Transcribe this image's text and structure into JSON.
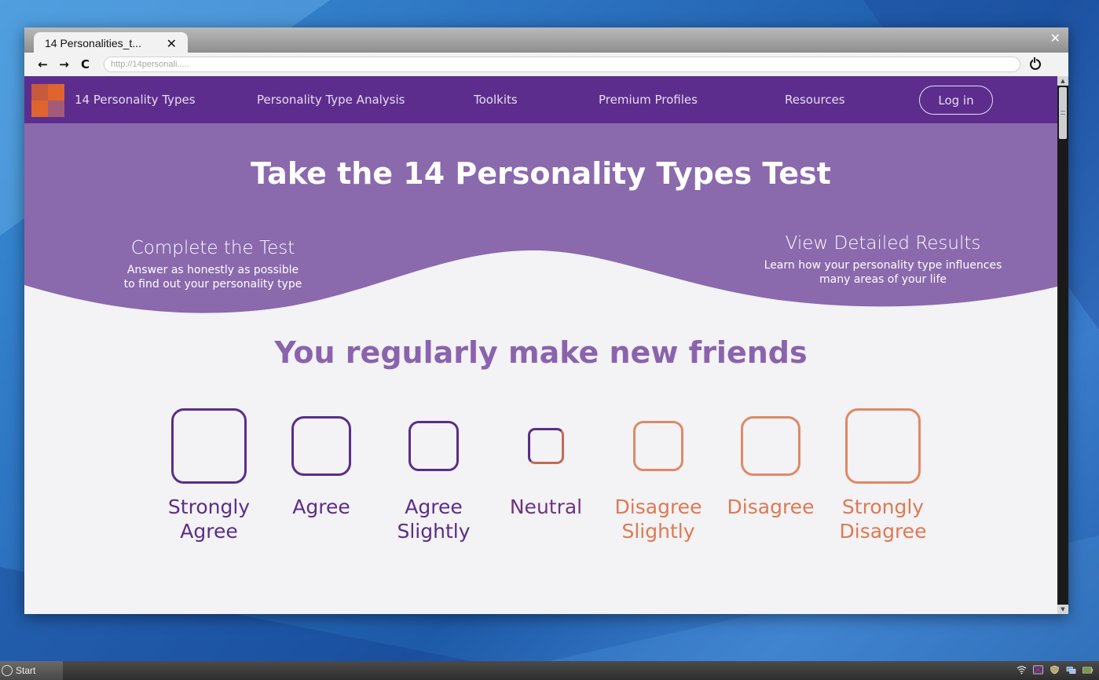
{
  "browser": {
    "tab_title": "14 Personalities_t...",
    "tab_close": "✕",
    "window_close": "✕",
    "url": "http://14personali.....",
    "nav": {
      "back": "←",
      "forward": "→",
      "reload": "C"
    }
  },
  "site": {
    "name": "14 Personality Types",
    "nav_links": [
      "Personality Type Analysis",
      "Toolkits",
      "Premium Profiles",
      "Resources"
    ],
    "login_label": "Log in",
    "colors": {
      "nav_bg": "#5d2d8e",
      "hero_bg": "#8a69ad",
      "accent_orange": "#e0642e"
    }
  },
  "hero": {
    "title": "Take the 14 Personality Types Test",
    "step_left": {
      "heading": "Complete the Test",
      "desc_line1": "Answer as honestly as possible",
      "desc_line2": "to find out your personality type"
    },
    "step_right": {
      "heading": "View Detailed Results",
      "desc_line1": "Learn how your personality type influences",
      "desc_line2": "many areas of your life"
    }
  },
  "question": {
    "text": "You regularly make new friends",
    "choices": [
      {
        "line1": "Strongly",
        "line2": "Agree",
        "color": "#5a2e88"
      },
      {
        "line1": "Agree",
        "line2": "",
        "color": "#5a2e88"
      },
      {
        "line1": "Agree",
        "line2": "Slightly",
        "color": "#5a2e88"
      },
      {
        "line1": "Neutral",
        "line2": "",
        "color": "#6b3580"
      },
      {
        "line1": "Disagree",
        "line2": "Slightly",
        "color": "#dd8a66"
      },
      {
        "line1": "Disagree",
        "line2": "",
        "color": "#dd8a66"
      },
      {
        "line1": "Strongly",
        "line2": "Disagree",
        "color": "#dd8a66"
      }
    ]
  },
  "taskbar": {
    "start_label": "Start",
    "tray_icons": [
      "wifi-icon",
      "flag-icon",
      "shield-icon",
      "network-icon",
      "battery-icon"
    ]
  }
}
